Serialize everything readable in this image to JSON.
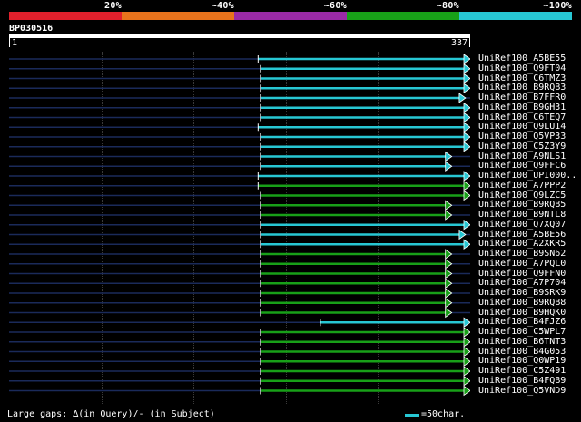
{
  "scale": {
    "labels": [
      "20%",
      "~40%",
      "~60%",
      "~80%",
      "~100%"
    ],
    "colors": [
      "#e0202c",
      "#e8731c",
      "#9a2aa6",
      "#18a018",
      "#27c7d4"
    ]
  },
  "query": {
    "name": "BP030516",
    "start": "1",
    "end": "337"
  },
  "hits": [
    {
      "name": "UniRef100_A5BE55",
      "start": 0.54,
      "end": 1.0,
      "color": "cyan"
    },
    {
      "name": "UniRef100_Q9FT04",
      "start": 0.545,
      "end": 1.0,
      "color": "cyan"
    },
    {
      "name": "UniRef100_C6TMZ3",
      "start": 0.545,
      "end": 1.0,
      "color": "cyan"
    },
    {
      "name": "UniRef100_B9RQB3",
      "start": 0.545,
      "end": 1.0,
      "color": "cyan"
    },
    {
      "name": "UniRef100_B7FFR0",
      "start": 0.545,
      "end": 0.99,
      "color": "cyan"
    },
    {
      "name": "UniRef100_B9GH31",
      "start": 0.545,
      "end": 1.0,
      "color": "cyan"
    },
    {
      "name": "UniRef100_C6TEQ7",
      "start": 0.545,
      "end": 1.0,
      "color": "cyan"
    },
    {
      "name": "UniRef100_Q9LU14",
      "start": 0.54,
      "end": 1.0,
      "color": "cyan"
    },
    {
      "name": "UniRef100_Q5VP33",
      "start": 0.545,
      "end": 1.0,
      "color": "cyan"
    },
    {
      "name": "UniRef100_C5Z3Y9",
      "start": 0.545,
      "end": 1.0,
      "color": "cyan"
    },
    {
      "name": "UniRef100_A9NLS1",
      "start": 0.545,
      "end": 0.96,
      "color": "cyan"
    },
    {
      "name": "UniRef100_Q9FFC6",
      "start": 0.545,
      "end": 0.96,
      "color": "cyan"
    },
    {
      "name": "UniRef100_UPI000..",
      "start": 0.54,
      "end": 1.0,
      "color": "cyan"
    },
    {
      "name": "UniRef100_A7PPP2",
      "start": 0.54,
      "end": 1.0,
      "color": "green"
    },
    {
      "name": "UniRef100_Q9LZC5",
      "start": 0.545,
      "end": 1.0,
      "color": "green"
    },
    {
      "name": "UniRef100_B9RQB5",
      "start": 0.545,
      "end": 0.96,
      "color": "green"
    },
    {
      "name": "UniRef100_B9NTL8",
      "start": 0.545,
      "end": 0.96,
      "color": "green"
    },
    {
      "name": "UniRef100_Q7XQ07",
      "start": 0.545,
      "end": 1.0,
      "color": "cyan"
    },
    {
      "name": "UniRef100_A5BE56",
      "start": 0.545,
      "end": 0.99,
      "color": "cyan"
    },
    {
      "name": "UniRef100_A2XKR5",
      "start": 0.545,
      "end": 1.0,
      "color": "cyan"
    },
    {
      "name": "UniRef100_B9SN62",
      "start": 0.545,
      "end": 0.96,
      "color": "green"
    },
    {
      "name": "UniRef100_A7PQL0",
      "start": 0.545,
      "end": 0.96,
      "color": "green"
    },
    {
      "name": "UniRef100_Q9FFN0",
      "start": 0.545,
      "end": 0.96,
      "color": "green"
    },
    {
      "name": "UniRef100_A7P704",
      "start": 0.545,
      "end": 0.96,
      "color": "green"
    },
    {
      "name": "UniRef100_B9SRK9",
      "start": 0.545,
      "end": 0.96,
      "color": "green"
    },
    {
      "name": "UniRef100_B9RQB8",
      "start": 0.545,
      "end": 0.96,
      "color": "green"
    },
    {
      "name": "UniRef100_B9HQK0",
      "start": 0.545,
      "end": 0.96,
      "color": "green"
    },
    {
      "name": "UniRef100_B4FJZ6",
      "start": 0.675,
      "end": 1.0,
      "color": "cyan"
    },
    {
      "name": "UniRef100_C5WPL7",
      "start": 0.545,
      "end": 1.0,
      "color": "green"
    },
    {
      "name": "UniRef100_B6TNT3",
      "start": 0.545,
      "end": 1.0,
      "color": "green"
    },
    {
      "name": "UniRef100_B4G053",
      "start": 0.545,
      "end": 1.0,
      "color": "green"
    },
    {
      "name": "UniRef100_Q0WP19",
      "start": 0.545,
      "end": 1.0,
      "color": "green"
    },
    {
      "name": "UniRef100_C5Z491",
      "start": 0.545,
      "end": 1.0,
      "color": "green"
    },
    {
      "name": "UniRef100_B4FQB9",
      "start": 0.545,
      "end": 1.0,
      "color": "green"
    },
    {
      "name": "UniRef100_Q5VND9",
      "start": 0.545,
      "end": 1.0,
      "color": "green"
    }
  ],
  "footer": {
    "gaps_text": "Large gaps: ∆(in Query)/- (in Subject)",
    "legend_text": "=50char."
  }
}
